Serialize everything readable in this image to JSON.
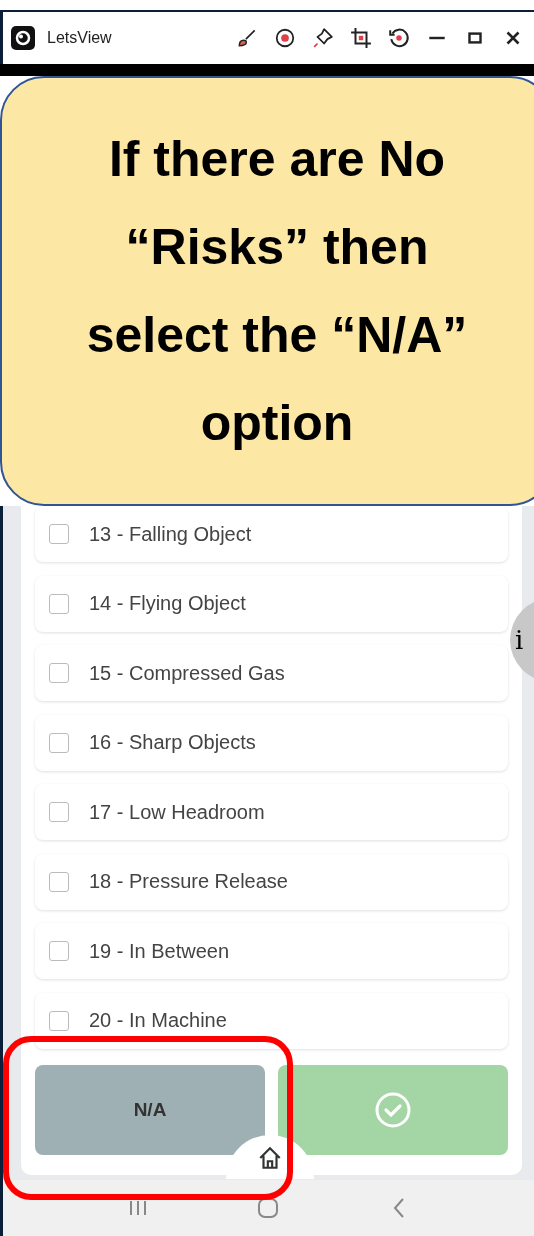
{
  "window": {
    "title": "LetsView"
  },
  "form": {
    "options": [
      {
        "label": "13 - Falling Object",
        "checked": false
      },
      {
        "label": "14 - Flying Object",
        "checked": false
      },
      {
        "label": "15 - Compressed Gas",
        "checked": false
      },
      {
        "label": "16 - Sharp Objects",
        "checked": false
      },
      {
        "label": "17 - Low Headroom",
        "checked": false
      },
      {
        "label": "18 - Pressure Release",
        "checked": false
      },
      {
        "label": "19 - In Between",
        "checked": false
      },
      {
        "label": "20 - In Machine",
        "checked": false
      }
    ],
    "buttons": [
      {
        "kind": "text",
        "label": "N/A"
      },
      {
        "kind": "confirm"
      }
    ]
  },
  "info_button": {
    "label": "i"
  },
  "callout": {
    "text": "If there are No “Risks” then select the “N/A” option"
  }
}
